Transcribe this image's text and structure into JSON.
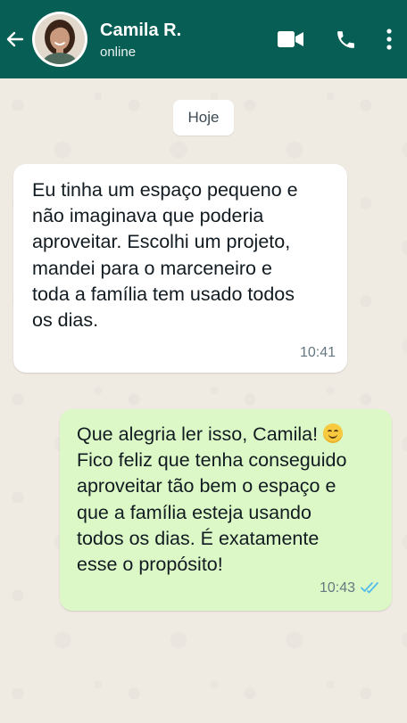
{
  "header": {
    "contact_name": "Camila R.",
    "status": "online",
    "background_color": "#075e54",
    "icons": [
      "back-arrow-icon",
      "video-call-icon",
      "phone-icon",
      "more-options-icon"
    ]
  },
  "chat": {
    "date_label": "Hoje",
    "messages": [
      {
        "direction": "incoming",
        "text": "Eu tinha um espaço pequeno e\nnão imaginava que poderia\naproveitar. Escolhi um projeto,\nmandei para o marceneiro e\ntoda a família tem usado todos\nos dias.",
        "time": "10:41"
      },
      {
        "direction": "outgoing",
        "text_line1": "Que alegria ler isso, Camila! ",
        "emoji": "smiling-face-emoji",
        "text_rest": "Fico feliz que tenha conseguido\naproveitar tão bem o espaço e\nque a família esteja usando\ntodos os dias. É exatamente\nesse o propósito!",
        "time": "10:43",
        "status": "read-double-check",
        "tick_color": "#53bdeb"
      }
    ],
    "colors": {
      "incoming_bubble": "#ffffff",
      "outgoing_bubble": "#dcf8c6",
      "background": "#efeae2"
    }
  }
}
